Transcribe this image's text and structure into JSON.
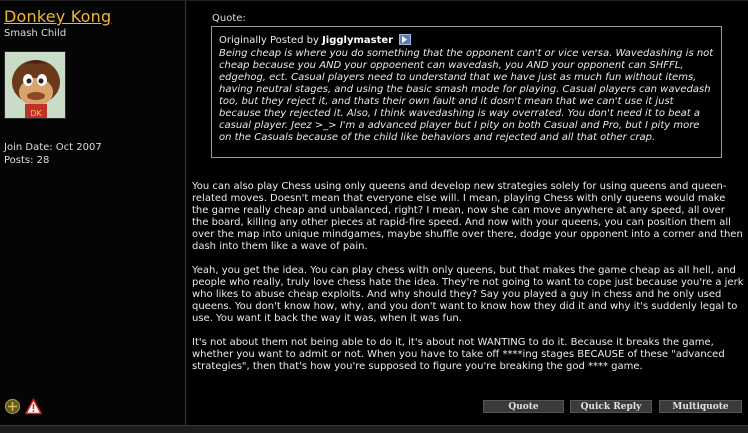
{
  "user": {
    "name": "Donkey Kong",
    "title": "Smash Child",
    "join_date": "Join Date: Oct 2007",
    "posts": "Posts: 28",
    "status_icons": [
      "offline-status-icon",
      "report-post-icon"
    ]
  },
  "quote": {
    "label": "Quote:",
    "posted_by_prefix": "Originally Posted by",
    "author": "Jigglymaster",
    "text": "Being cheap is where you do something that the opponent can't or vice versa. Wavedashing is not cheap because you AND your oppoenent can wavedash, you AND your opponent can SHFFL, edgehog, ect. Casual players need to understand that we have just as much fun without items, having neutral stages, and using the basic smash mode for playing. Casual players can wavedash too, but they reject it, and thats their own fault and it dosn't mean that we can't use it just because they rejected it. Also, I think wavedashing is way overrated. You don't need it to beat a casual player. Jeez >_> I'm a advanced player but I pity on both Casual and Pro, but I pity more on the Casuals because of the child like behaviors and rejected and all that other crap."
  },
  "message": {
    "paragraphs": [
      "You can also play Chess using only queens and develop new strategies solely for using queens and queen-related moves. Doesn't mean that everyone else will. I mean, playing Chess with only queens would make the game really cheap and unbalanced, right? I mean, now she can move anywhere at any speed, all over the board, killing any other pieces at rapid-fire speed. And now with your queens, you can position them all over the map into unique mindgames, maybe shuffle over there, dodge your opponent into a corner and then dash into them like a wave of pain.",
      "Yeah, you get the idea. You can play chess with only queens, but that makes the game cheap as all hell, and people who really, truly love chess hate the idea. They're not going to want to cope just because you're a jerk who likes to abuse cheap exploits. And why should they? Say you played a guy in chess and he only used queens. You don't know how, why, and you don't want to know how they did it and why it's suddenly legal to use. You want it back the way it was, when it was fun.",
      "It's not about them not being able to do it, it's about not WANTING to do it. Because it breaks the game, whether you want to admit or not. When you have to take off ****ing stages BECAUSE of these \"advanced strategies\", then that's how you're supposed to figure you're breaking the god **** game."
    ]
  },
  "buttons": {
    "quote": "Quote",
    "quick_reply": "Quick Reply",
    "multiquote": "Multiquote"
  }
}
